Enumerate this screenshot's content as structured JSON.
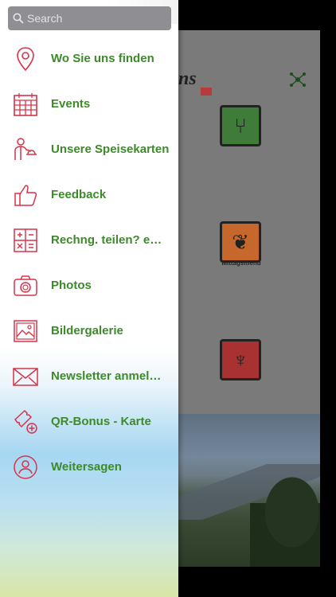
{
  "search": {
    "placeholder": "Search"
  },
  "menu": {
    "items": [
      {
        "label": "Wo Sie uns finden",
        "icon": "location-pin-icon"
      },
      {
        "label": "Events",
        "icon": "calendar-icon"
      },
      {
        "label": "Unsere Speisekarten",
        "icon": "waiter-icon"
      },
      {
        "label": "Feedback",
        "icon": "thumbs-up-icon"
      },
      {
        "label": "Rechng. teilen? e…",
        "icon": "calculator-icon"
      },
      {
        "label": "Photos",
        "icon": "camera-icon"
      },
      {
        "label": "Bildergalerie",
        "icon": "image-gallery-icon"
      },
      {
        "label": "Newsletter anmel…",
        "icon": "envelope-icon"
      },
      {
        "label": "QR-Bonus - Karte",
        "icon": "qr-ticket-icon"
      },
      {
        "label": "Weitersagen",
        "icon": "share-person-icon"
      }
    ]
  },
  "background": {
    "tile_label": "Mittagsmenü",
    "logo_fragment": "ns"
  },
  "colors": {
    "icon": "#d6334a",
    "label": "#3d8a2a",
    "search_bg": "#8e8e93"
  }
}
